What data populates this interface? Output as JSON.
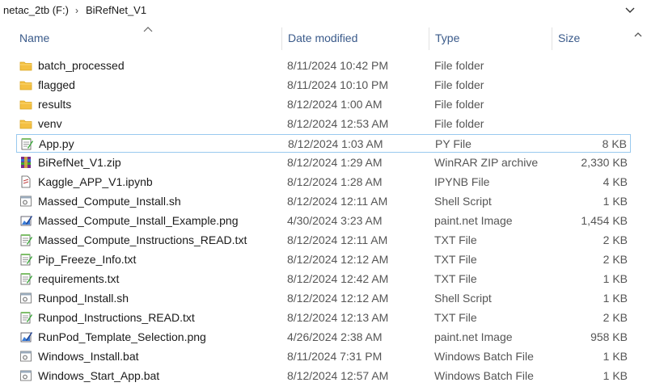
{
  "breadcrumb": {
    "drive": "netac_2tb (F:)",
    "folder": "BiRefNet_V1",
    "separator": "›"
  },
  "columns": {
    "name": "Name",
    "date": "Date modified",
    "type": "Type",
    "size": "Size"
  },
  "files": [
    {
      "name": "batch_processed",
      "date": "8/11/2024 10:42 PM",
      "type": "File folder",
      "size": "",
      "icon": "folder-icon"
    },
    {
      "name": "flagged",
      "date": "8/11/2024 10:10 PM",
      "type": "File folder",
      "size": "",
      "icon": "folder-icon"
    },
    {
      "name": "results",
      "date": "8/12/2024 1:00 AM",
      "type": "File folder",
      "size": "",
      "icon": "folder-icon"
    },
    {
      "name": "venv",
      "date": "8/12/2024 12:53 AM",
      "type": "File folder",
      "size": "",
      "icon": "folder-icon"
    },
    {
      "name": "App.py",
      "date": "8/12/2024 1:03 AM",
      "type": "PY File",
      "size": "8 KB",
      "icon": "notepad-icon"
    },
    {
      "name": "BiRefNet_V1.zip",
      "date": "8/12/2024 1:29 AM",
      "type": "WinRAR ZIP archive",
      "size": "2,330 KB",
      "icon": "winrar-icon"
    },
    {
      "name": "Kaggle_APP_V1.ipynb",
      "date": "8/12/2024 1:28 AM",
      "type": "IPYNB File",
      "size": "4 KB",
      "icon": "document-icon"
    },
    {
      "name": "Massed_Compute_Install.sh",
      "date": "8/12/2024 12:11 AM",
      "type": "Shell Script",
      "size": "1 KB",
      "icon": "script-icon"
    },
    {
      "name": "Massed_Compute_Install_Example.png",
      "date": "4/30/2024 3:23 AM",
      "type": "paint.net Image",
      "size": "1,454 KB",
      "icon": "paintnet-icon"
    },
    {
      "name": "Massed_Compute_Instructions_READ.txt",
      "date": "8/12/2024 12:11 AM",
      "type": "TXT File",
      "size": "2 KB",
      "icon": "notepad-icon"
    },
    {
      "name": "Pip_Freeze_Info.txt",
      "date": "8/12/2024 12:12 AM",
      "type": "TXT File",
      "size": "2 KB",
      "icon": "notepad-icon"
    },
    {
      "name": "requirements.txt",
      "date": "8/12/2024 12:42 AM",
      "type": "TXT File",
      "size": "1 KB",
      "icon": "notepad-icon"
    },
    {
      "name": "Runpod_Install.sh",
      "date": "8/12/2024 12:12 AM",
      "type": "Shell Script",
      "size": "1 KB",
      "icon": "script-icon"
    },
    {
      "name": "Runpod_Instructions_READ.txt",
      "date": "8/12/2024 12:13 AM",
      "type": "TXT File",
      "size": "2 KB",
      "icon": "notepad-icon"
    },
    {
      "name": "RunPod_Template_Selection.png",
      "date": "4/26/2024 2:38 AM",
      "type": "paint.net Image",
      "size": "958 KB",
      "icon": "paintnet-icon"
    },
    {
      "name": "Windows_Install.bat",
      "date": "8/11/2024 7:31 PM",
      "type": "Windows Batch File",
      "size": "1 KB",
      "icon": "script-icon"
    },
    {
      "name": "Windows_Start_App.bat",
      "date": "8/12/2024 12:57 AM",
      "type": "Windows Batch File",
      "size": "1 KB",
      "icon": "script-icon"
    }
  ],
  "selected_index": 4,
  "colors": {
    "header_text": "#3a5a8a",
    "selection_border": "#99c9ef",
    "folder": "#f4c042"
  }
}
